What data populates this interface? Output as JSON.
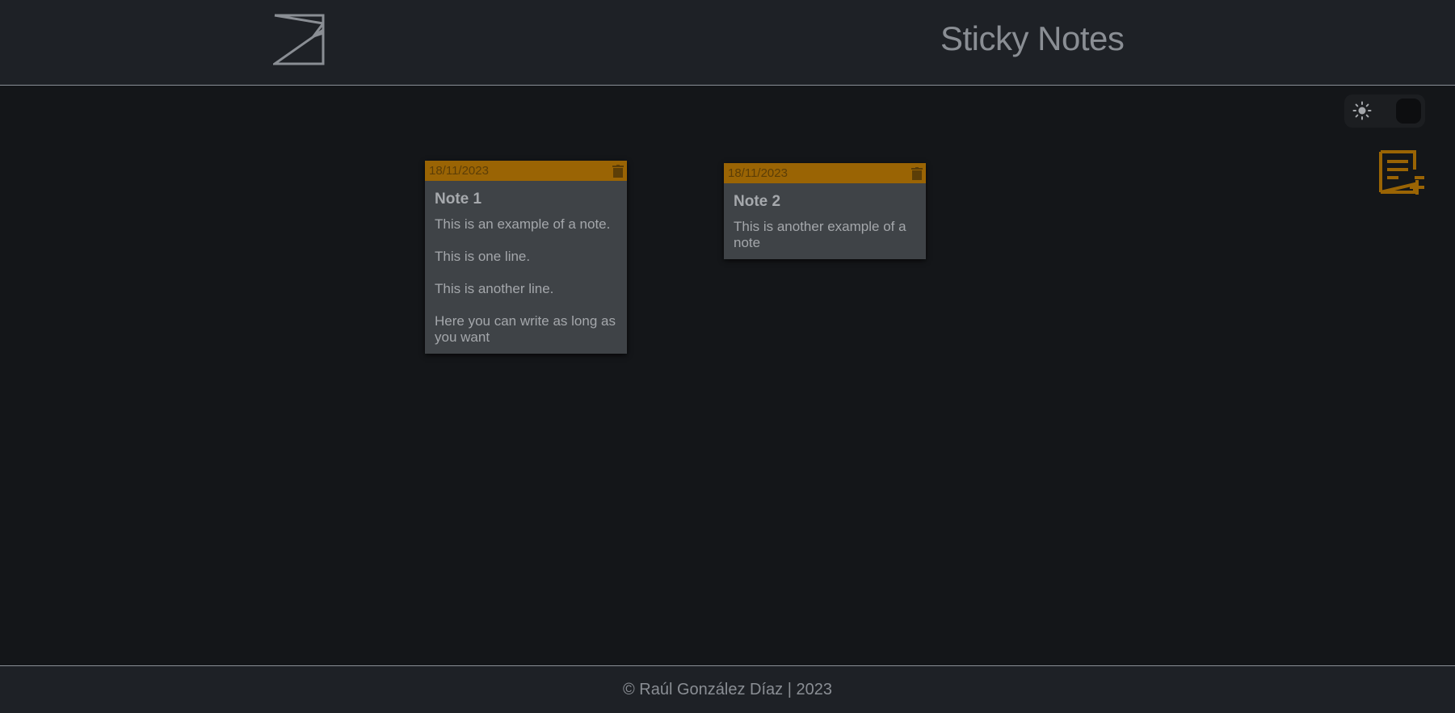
{
  "header": {
    "logo_icon": "sticky-note-icon",
    "title": "Sticky Notes"
  },
  "controls": {
    "theme_toggle_icon": "sun-icon",
    "theme_mode": "dark",
    "add_note_icon": "add-note-icon"
  },
  "notes": [
    {
      "date": "18/11/2023",
      "title": "Note 1",
      "lines": [
        "This is an example of a note.",
        "This is one line.",
        "This is another line.",
        "Here you can write as long as you want"
      ]
    },
    {
      "date": "18/11/2023",
      "title": "Note 2",
      "lines": [
        "This is another example of a note"
      ]
    }
  ],
  "footer": {
    "text": "© Raúl González Díaz | 2023"
  },
  "colors": {
    "background": "#141619",
    "header_bg": "#1e2126",
    "accent": "#9a6404",
    "note_bg": "#3f4347",
    "text_muted": "#8a8e94"
  }
}
